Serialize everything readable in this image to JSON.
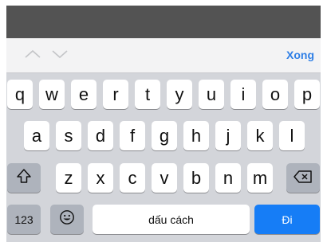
{
  "accessory": {
    "up_icon": "chevron-up-icon",
    "down_icon": "chevron-down-icon",
    "done_label": "Xong"
  },
  "keyboard": {
    "row1": [
      "q",
      "w",
      "e",
      "r",
      "t",
      "y",
      "u",
      "i",
      "o",
      "p"
    ],
    "row2": [
      "a",
      "s",
      "d",
      "f",
      "g",
      "h",
      "j",
      "k",
      "l"
    ],
    "row3": [
      "z",
      "x",
      "c",
      "v",
      "b",
      "n",
      "m"
    ],
    "shift_icon": "shift-icon",
    "delete_icon": "delete-icon",
    "numbers_label": "123",
    "emoji_icon": "emoji-icon",
    "space_label": "dấu cách",
    "go_label": "Đi"
  },
  "colors": {
    "accent": "#2f7fe6",
    "go_button": "#167df6",
    "keyboard_bg": "#d3d5da",
    "special_key": "#aeb3bc"
  }
}
